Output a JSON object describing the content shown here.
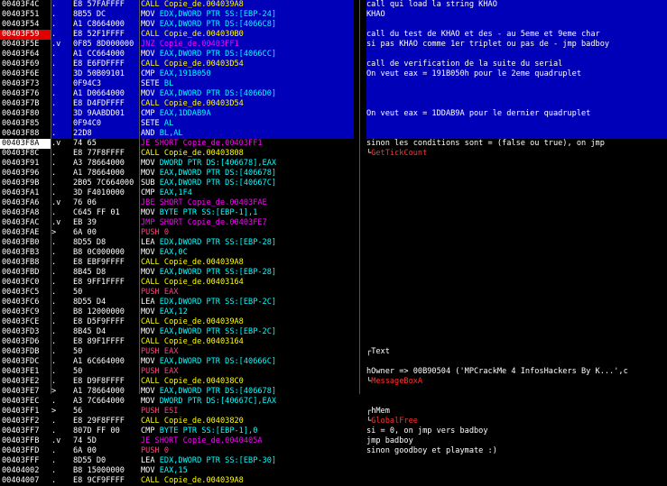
{
  "colors": {
    "background": "#000000",
    "text": "#ffffff",
    "call": "#ffff00",
    "jump": "#ff00ff",
    "push": "#ff4080",
    "reg": "#00ffff",
    "api": "#ff3030",
    "breakpoint": "#e00000",
    "selected": "#0000b8"
  },
  "rows": [
    {
      "addr": "00403F4C",
      "mark": ".",
      "hex": "E8 57FAFFFF",
      "op": "CALL",
      "args": "Copie_de.004039A8",
      "kind": "call",
      "comment": "call qui load la string KHAO",
      "sel": true
    },
    {
      "addr": "00403F51",
      "mark": ".",
      "hex": "8B55 DC",
      "op": "MOV",
      "args": "EDX,DWORD PTR SS:[EBP-24]",
      "kind": "mov",
      "comment": "KHAO",
      "sel": true
    },
    {
      "addr": "00403F54",
      "mark": ".",
      "hex": "A1 C8664000",
      "op": "MOV",
      "args": "EAX,DWORD PTR DS:[4066C8]",
      "kind": "mov",
      "comment": "",
      "sel": true
    },
    {
      "addr": "00403F59",
      "mark": ".",
      "hex": "E8 52F1FFFF",
      "op": "CALL",
      "args": "Copie_de.004030B0",
      "kind": "call",
      "comment": "call du test de KHAO et des - au 5eme et 9eme char",
      "sel": true,
      "bp": true
    },
    {
      "addr": "00403F5E",
      "mark": ".v",
      "hex": "0F85 8D000000",
      "op": "JNZ",
      "args": "Copie_de.00403FF1",
      "kind": "jump",
      "comment": "si pas KHAO comme 1er triplet ou pas de - jmp badboy",
      "sel": true
    },
    {
      "addr": "00403F64",
      "mark": ".",
      "hex": "A1 CC664000",
      "op": "MOV",
      "args": "EAX,DWORD PTR DS:[4066CC]",
      "kind": "mov",
      "comment": "",
      "sel": true
    },
    {
      "addr": "00403F69",
      "mark": ".",
      "hex": "E8 E6FDFFFF",
      "op": "CALL",
      "args": "Copie_de.00403D54",
      "kind": "call",
      "comment": "call de verification de la suite du serial",
      "sel": true
    },
    {
      "addr": "00403F6E",
      "mark": ".",
      "hex": "3D 50B09101",
      "op": "CMP",
      "args": "EAX,191B050",
      "kind": "cmp",
      "comment": "On veut eax = 191B050h pour le 2eme quadruplet",
      "sel": true
    },
    {
      "addr": "00403F73",
      "mark": ".",
      "hex": "0F94C3",
      "op": "SETE",
      "args": "BL",
      "kind": "cmp",
      "comment": "",
      "sel": true
    },
    {
      "addr": "00403F76",
      "mark": ".",
      "hex": "A1 D0664000",
      "op": "MOV",
      "args": "EAX,DWORD PTR DS:[4066D0]",
      "kind": "mov",
      "comment": "",
      "sel": true
    },
    {
      "addr": "00403F7B",
      "mark": ".",
      "hex": "E8 D4FDFFFF",
      "op": "CALL",
      "args": "Copie_de.00403D54",
      "kind": "call",
      "comment": "",
      "sel": true
    },
    {
      "addr": "00403F80",
      "mark": ".",
      "hex": "3D 9AABDD01",
      "op": "CMP",
      "args": "EAX,1DDAB9A",
      "kind": "cmp",
      "comment": "On veut eax = 1DDAB9A pour le dernier quadruplet",
      "sel": true
    },
    {
      "addr": "00403F85",
      "mark": ".",
      "hex": "0F94C0",
      "op": "SETE",
      "args": "AL",
      "kind": "cmp",
      "comment": "",
      "sel": true
    },
    {
      "addr": "00403F88",
      "mark": ".",
      "hex": "22D8",
      "op": "AND",
      "args": "BL,AL",
      "kind": "cmp",
      "comment": "",
      "sel": true
    },
    {
      "addr": "00403F8A",
      "mark": ".v",
      "hex": "74 65",
      "op": "JE",
      "args": "SHORT Copie_de.00403FF1",
      "kind": "jump",
      "comment": "sinon les conditions sont = (false ou true), on jmp",
      "eip": true
    },
    {
      "addr": "00403F8C",
      "mark": ".",
      "hex": "E8 77F8FFFF",
      "op": "CALL",
      "args": "Copie_de.00403808",
      "kind": "call",
      "comment": "GetTickCount",
      "cmtkind": "api",
      "cmtmark": true
    },
    {
      "addr": "00403F91",
      "mark": ".",
      "hex": "A3 78664000",
      "op": "MOV",
      "args": "DWORD PTR DS:[406678],EAX",
      "kind": "mov",
      "comment": ""
    },
    {
      "addr": "00403F96",
      "mark": ".",
      "hex": "A1 78664000",
      "op": "MOV",
      "args": "EAX,DWORD PTR DS:[406678]",
      "kind": "mov",
      "comment": ""
    },
    {
      "addr": "00403F9B",
      "mark": ".",
      "hex": "2B05 7C664000",
      "op": "SUB",
      "args": "EAX,DWORD PTR DS:[40667C]",
      "kind": "mov",
      "comment": ""
    },
    {
      "addr": "00403FA1",
      "mark": ".",
      "hex": "3D F4010000",
      "op": "CMP",
      "args": "EAX,1F4",
      "kind": "cmp",
      "comment": ""
    },
    {
      "addr": "00403FA6",
      "mark": ".v",
      "hex": "76 06",
      "op": "JBE",
      "args": "SHORT Copie_de.00403FAE",
      "kind": "jump",
      "comment": ""
    },
    {
      "addr": "00403FA8",
      "mark": ".",
      "hex": "C645 FF 01",
      "op": "MOV",
      "args": "BYTE PTR SS:[EBP-1],1",
      "kind": "mov",
      "comment": ""
    },
    {
      "addr": "00403FAC",
      "mark": ".v",
      "hex": "EB 39",
      "op": "JMP",
      "args": "SHORT Copie_de.00403FE7",
      "kind": "jump",
      "comment": ""
    },
    {
      "addr": "00403FAE",
      "mark": ">",
      "hex": "6A 00",
      "op": "PUSH",
      "args": "0",
      "kind": "push",
      "comment": ""
    },
    {
      "addr": "00403FB0",
      "mark": ".",
      "hex": "8D55 D8",
      "op": "LEA",
      "args": "EDX,DWORD PTR SS:[EBP-28]",
      "kind": "mov",
      "comment": ""
    },
    {
      "addr": "00403FB3",
      "mark": ".",
      "hex": "B8 0C000000",
      "op": "MOV",
      "args": "EAX,0C",
      "kind": "mov",
      "comment": ""
    },
    {
      "addr": "00403FB8",
      "mark": ".",
      "hex": "E8 EBF9FFFF",
      "op": "CALL",
      "args": "Copie_de.004039A8",
      "kind": "call",
      "comment": ""
    },
    {
      "addr": "00403FBD",
      "mark": ".",
      "hex": "8B45 D8",
      "op": "MOV",
      "args": "EAX,DWORD PTR SS:[EBP-28]",
      "kind": "mov",
      "comment": ""
    },
    {
      "addr": "00403FC0",
      "mark": ".",
      "hex": "E8 9FF1FFFF",
      "op": "CALL",
      "args": "Copie_de.00403164",
      "kind": "call",
      "comment": ""
    },
    {
      "addr": "00403FC5",
      "mark": ".",
      "hex": "50",
      "op": "PUSH",
      "args": "EAX",
      "kind": "push",
      "comment": ""
    },
    {
      "addr": "00403FC6",
      "mark": ".",
      "hex": "8D55 D4",
      "op": "LEA",
      "args": "EDX,DWORD PTR SS:[EBP-2C]",
      "kind": "mov",
      "comment": ""
    },
    {
      "addr": "00403FC9",
      "mark": ".",
      "hex": "B8 12000000",
      "op": "MOV",
      "args": "EAX,12",
      "kind": "mov",
      "comment": ""
    },
    {
      "addr": "00403FCE",
      "mark": ".",
      "hex": "E8 D5F9FFFF",
      "op": "CALL",
      "args": "Copie_de.004039A8",
      "kind": "call",
      "comment": ""
    },
    {
      "addr": "00403FD3",
      "mark": ".",
      "hex": "8B45 D4",
      "op": "MOV",
      "args": "EAX,DWORD PTR SS:[EBP-2C]",
      "kind": "mov",
      "comment": ""
    },
    {
      "addr": "00403FD6",
      "mark": ".",
      "hex": "E8 89F1FFFF",
      "op": "CALL",
      "args": "Copie_de.00403164",
      "kind": "call",
      "comment": ""
    },
    {
      "addr": "00403FDB",
      "mark": ".",
      "hex": "50",
      "op": "PUSH",
      "args": "EAX",
      "kind": "push",
      "comment": "Text",
      "cmtmark": true
    },
    {
      "addr": "00403FDC",
      "mark": ".",
      "hex": "A1 6C664000",
      "op": "MOV",
      "args": "EAX,DWORD PTR DS:[40666C]",
      "kind": "mov",
      "comment": ""
    },
    {
      "addr": "00403FE1",
      "mark": ".",
      "hex": "50",
      "op": "PUSH",
      "args": "EAX",
      "kind": "push",
      "comment": "hOwner => 00B90504 ('MPCrackMe 4 InfosHackers By K...',c"
    },
    {
      "addr": "00403FE2",
      "mark": ".",
      "hex": "E8 D9F8FFFF",
      "op": "CALL",
      "args": "Copie_de.004038C0",
      "kind": "call",
      "comment": "MessageBoxA",
      "cmtkind": "api",
      "cmtmark": true
    },
    {
      "addr": "00403FE7",
      "mark": ">",
      "hex": "A1 78664000",
      "op": "MOV",
      "args": "EAX,DWORD PTR DS:[406678]",
      "kind": "mov",
      "comment": ""
    },
    {
      "addr": "00403FEC",
      "mark": ".",
      "hex": "A3 7C664000",
      "op": "MOV",
      "args": "DWORD PTR DS:[40667C],EAX",
      "kind": "mov",
      "comment": ""
    },
    {
      "addr": "00403FF1",
      "mark": ">",
      "hex": "56",
      "op": "PUSH",
      "args": "ESI",
      "kind": "push",
      "comment": "hMem",
      "cmtmark": true
    },
    {
      "addr": "00403FF2",
      "mark": ".",
      "hex": "E8 29F8FFFF",
      "op": "CALL",
      "args": "Copie_de.00403820",
      "kind": "call",
      "comment": "GlobalFree",
      "cmtkind": "api",
      "cmtmark": true
    },
    {
      "addr": "00403FF7",
      "mark": ".",
      "hex": "807D FF 00",
      "op": "CMP",
      "args": "BYTE PTR SS:[EBP-1],0",
      "kind": "cmp",
      "comment": "si = 0, on jmp vers badboy"
    },
    {
      "addr": "00403FFB",
      "mark": ".v",
      "hex": "74 5D",
      "op": "JE",
      "args": "SHORT Copie_de.0040405A",
      "kind": "jump",
      "comment": "jmp badboy"
    },
    {
      "addr": "00403FFD",
      "mark": ".",
      "hex": "6A 00",
      "op": "PUSH",
      "args": "0",
      "kind": "push",
      "comment": "sinon goodboy et playmate :)"
    },
    {
      "addr": "00403FFF",
      "mark": ".",
      "hex": "8D55 D0",
      "op": "LEA",
      "args": "EDX,DWORD PTR SS:[EBP-30]",
      "kind": "mov",
      "comment": ""
    },
    {
      "addr": "00404002",
      "mark": ".",
      "hex": "B8 15000000",
      "op": "MOV",
      "args": "EAX,15",
      "kind": "mov",
      "comment": ""
    },
    {
      "addr": "00404007",
      "mark": ".",
      "hex": "E8 9CF9FFFF",
      "op": "CALL",
      "args": "Copie_de.004039A8",
      "kind": "call",
      "comment": ""
    }
  ]
}
